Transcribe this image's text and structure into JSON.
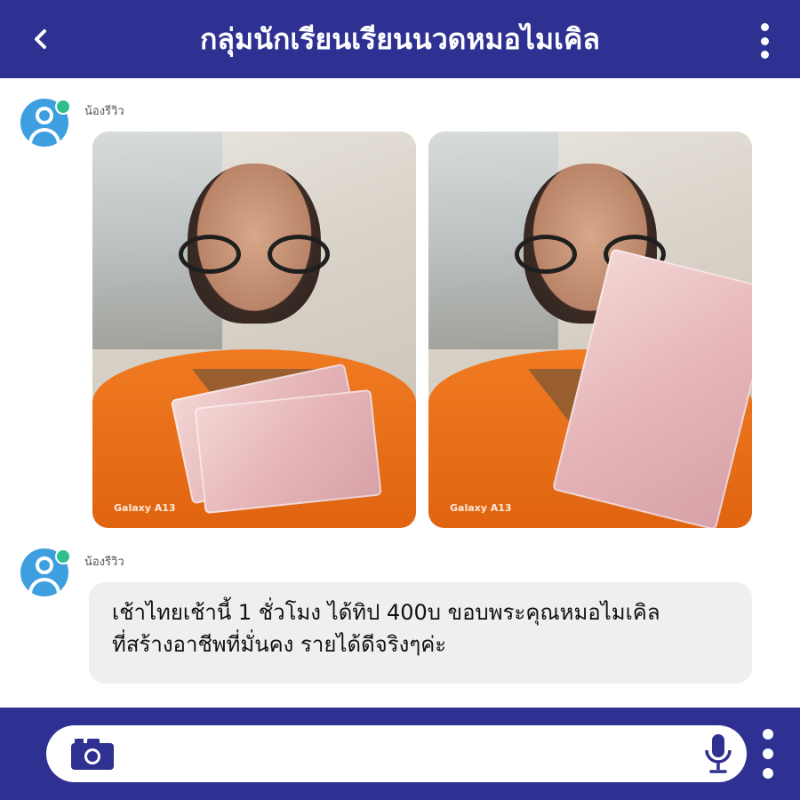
{
  "header": {
    "title": "กลุ่มนักเรียนเรียนนวดหมอไมเคิล",
    "back_icon": "chevron-left-icon",
    "menu_icon": "more-vertical-icon",
    "background": "#2e3192"
  },
  "messages": [
    {
      "sender": "น้องรีวิว",
      "type": "photos",
      "photos": [
        {
          "watermark": "Galaxy A13"
        },
        {
          "watermark": "Galaxy A13"
        }
      ]
    },
    {
      "sender": "น้องรีวิว",
      "type": "text",
      "lines": [
        "เช้าไทยเช้านี้ 1 ชั่วโมง ได้ทิป 400บ ขอบพระคุณหมอไมเคิล",
        "ที่สร้างอาชีพที่มั่นคง รายได้ดีจริงๆค่ะ"
      ]
    }
  ],
  "footer": {
    "camera_icon": "camera-icon",
    "mic_icon": "microphone-icon",
    "menu_icon": "more-vertical-icon",
    "input_placeholder": ""
  },
  "colors": {
    "accent": "#2e3192",
    "avatar": "#3e9fe0",
    "online": "#2ec08a",
    "bubble": "#efefef"
  }
}
